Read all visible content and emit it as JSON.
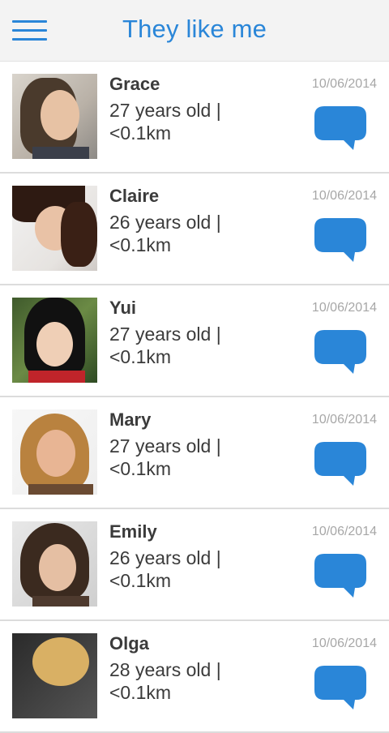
{
  "header": {
    "title": "They like me",
    "menu_icon": "hamburger-menu-icon"
  },
  "colors": {
    "accent": "#2a86d8",
    "header_bg": "#f3f3f3",
    "date": "#a7a7a7"
  },
  "users": [
    {
      "name": "Grace",
      "age_line": "27 years old |",
      "distance": "<0.1km",
      "date": "10/06/2014"
    },
    {
      "name": "Claire",
      "age_line": "26 years old |",
      "distance": "<0.1km",
      "date": "10/06/2014"
    },
    {
      "name": "Yui",
      "age_line": "27 years old |",
      "distance": "<0.1km",
      "date": "10/06/2014"
    },
    {
      "name": "Mary",
      "age_line": "27 years old |",
      "distance": "<0.1km",
      "date": "10/06/2014"
    },
    {
      "name": "Emily",
      "age_line": "26 years old |",
      "distance": "<0.1km",
      "date": "10/06/2014"
    },
    {
      "name": "Olga",
      "age_line": "28 years old |",
      "distance": "<0.1km",
      "date": "10/06/2014"
    }
  ]
}
